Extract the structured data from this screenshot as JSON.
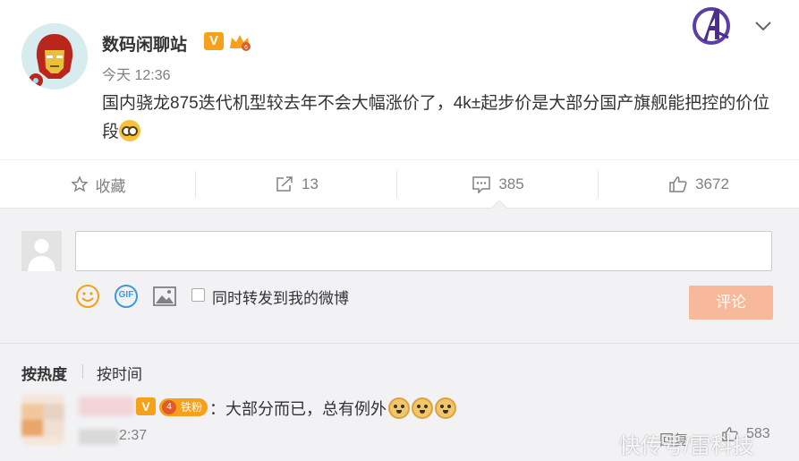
{
  "post": {
    "author": "数码闲聊站",
    "verified_badge": "V",
    "time": "今天 12:36",
    "text": "国内骁龙875迭代机型较去年不会大幅涨价了，4k±起步价是大部分国产旗舰能把控的价位段",
    "avatar_icon": "iron-man-avatar",
    "emoji_icon": "shocked-emoji"
  },
  "actions": {
    "favorite_label": "收藏",
    "repost_count": "13",
    "comment_count": "385",
    "like_count": "3672"
  },
  "composer": {
    "input_value": "",
    "repost_label": "同时转发到我的微博",
    "submit_label": "评论",
    "gif_label": "GIF"
  },
  "sort": {
    "hot": "按热度",
    "time": "按时间"
  },
  "comment": {
    "verified_badge": "V",
    "fan_badge": "铁粉",
    "fan_level": "4",
    "text": "：大部分而已，总有例外",
    "time": "2:37",
    "reply_label": "回复",
    "like_count": "583"
  },
  "watermark": "快传号/雷科技",
  "colors": {
    "accent_orange": "#f7a11a",
    "submit_disabled": "#f7b99a",
    "comment_bg": "#f2f2f5",
    "muted_text": "#808080"
  }
}
